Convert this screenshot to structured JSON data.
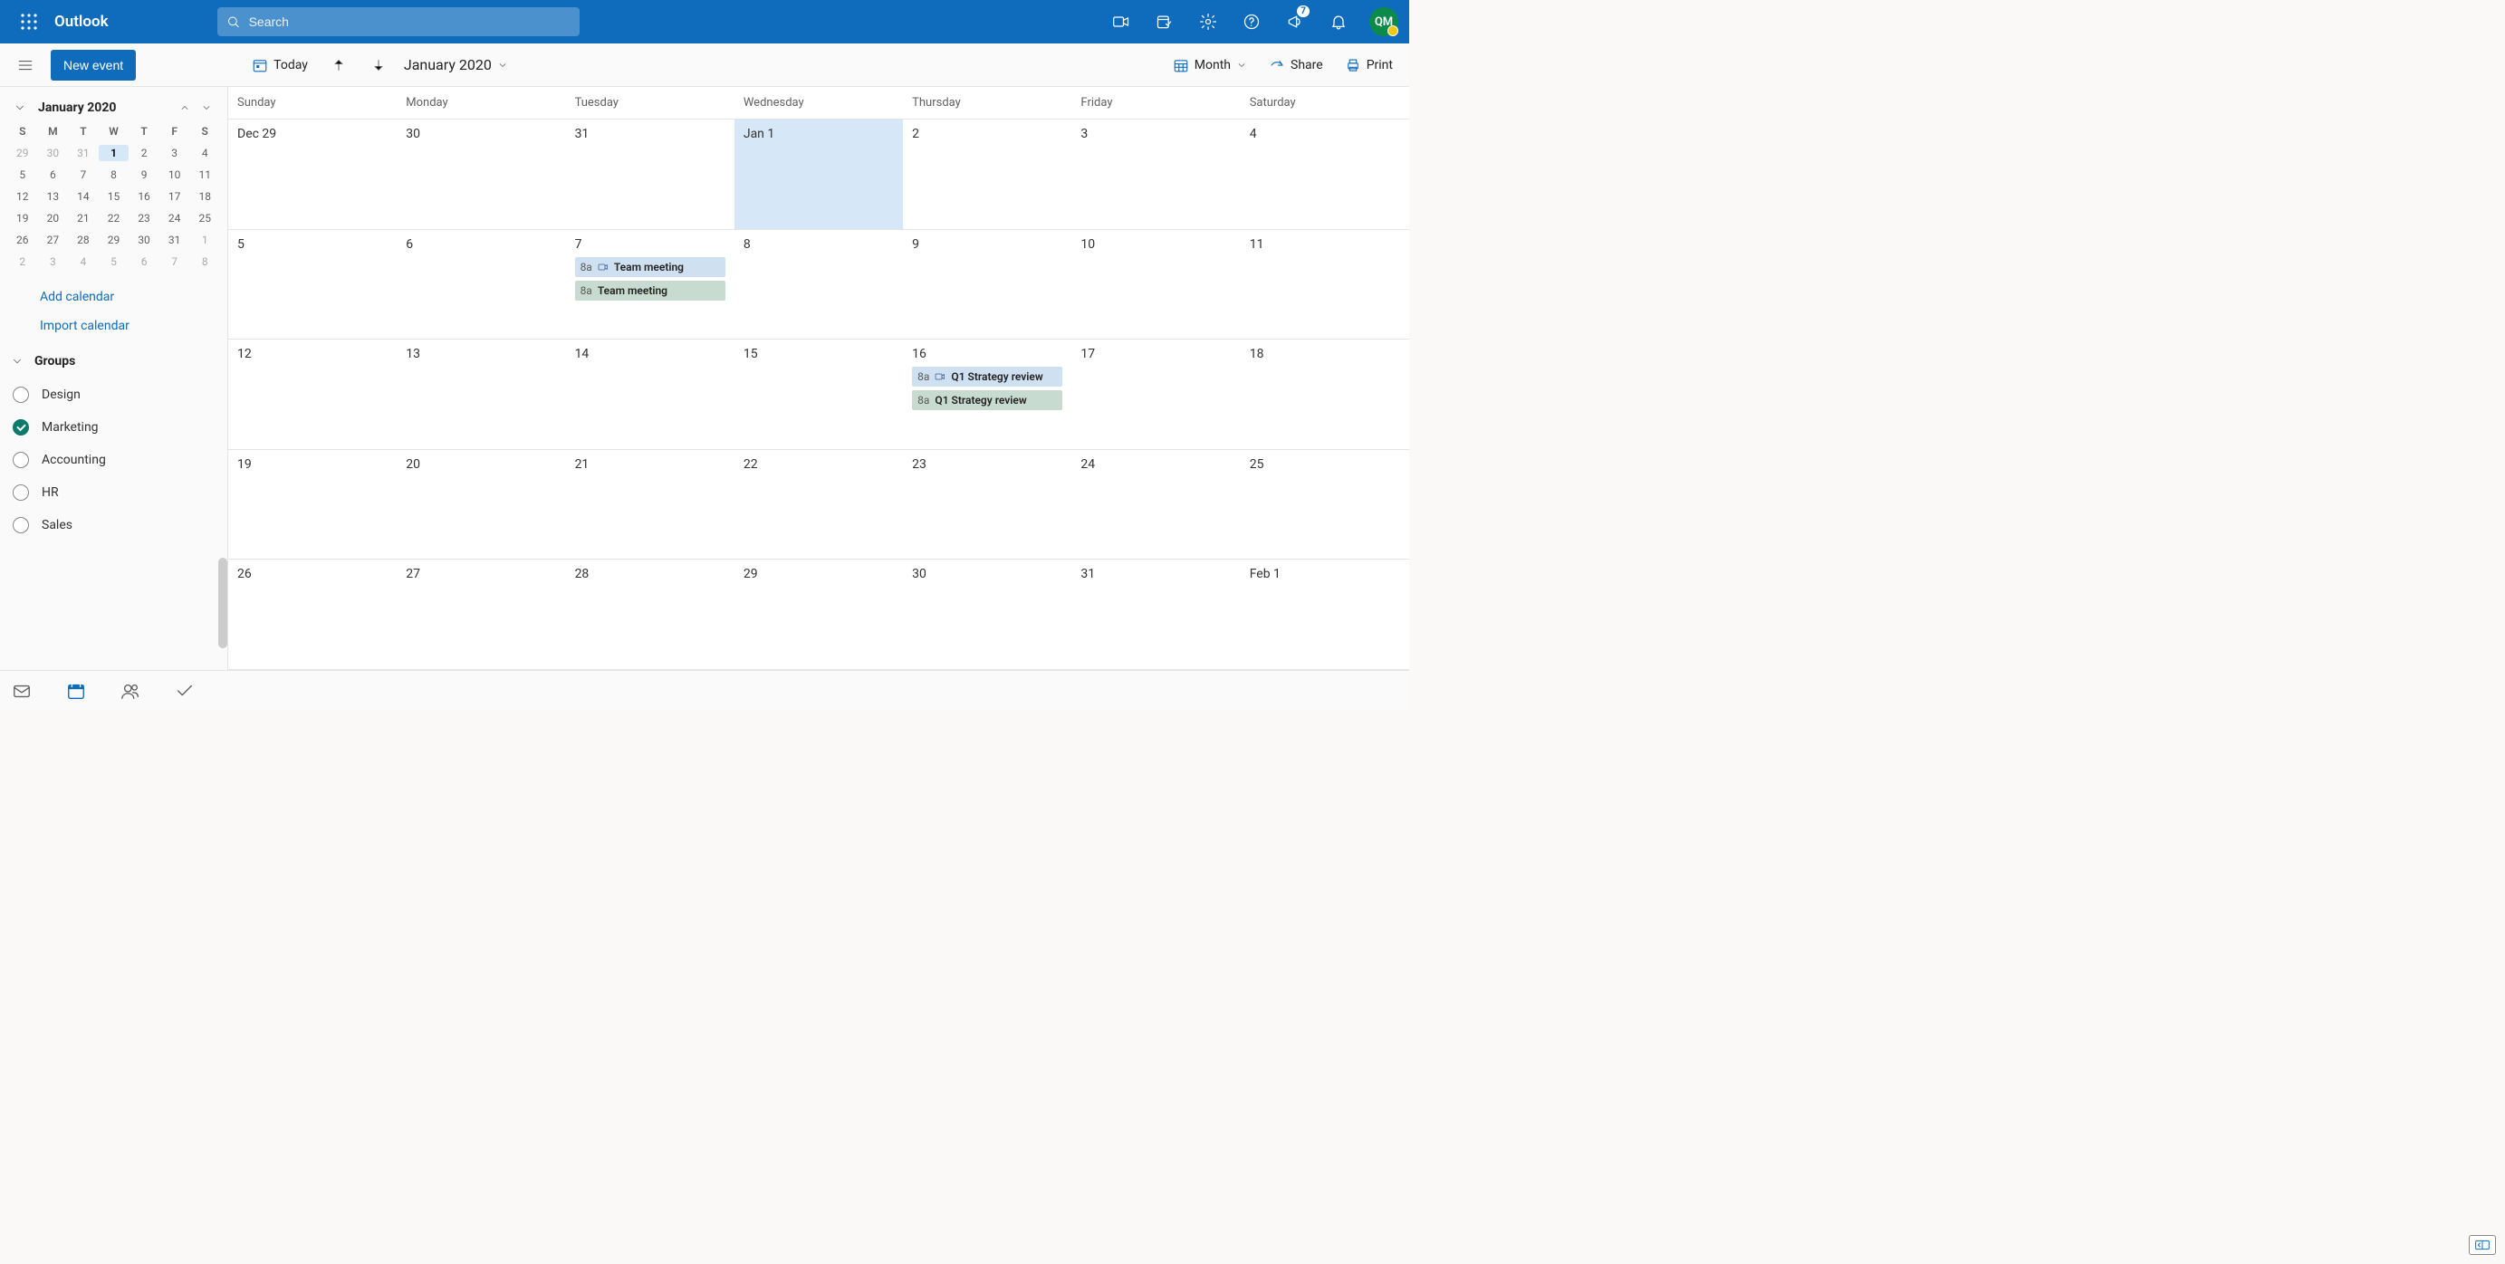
{
  "header": {
    "brand": "Outlook",
    "search_placeholder": "Search",
    "whats_new_badge": "7",
    "avatar_initials": "QM"
  },
  "commandbar": {
    "new_event": "New event",
    "today": "Today",
    "title": "January 2020",
    "view": "Month",
    "share": "Share",
    "print": "Print"
  },
  "sidebar": {
    "mini_title": "January 2020",
    "dow": [
      "S",
      "M",
      "T",
      "W",
      "T",
      "F",
      "S"
    ],
    "days": [
      [
        "29",
        "30",
        "31",
        "1",
        "2",
        "3",
        "4"
      ],
      [
        "5",
        "6",
        "7",
        "8",
        "9",
        "10",
        "11"
      ],
      [
        "12",
        "13",
        "14",
        "15",
        "16",
        "17",
        "18"
      ],
      [
        "19",
        "20",
        "21",
        "22",
        "23",
        "24",
        "25"
      ],
      [
        "26",
        "27",
        "28",
        "29",
        "30",
        "31",
        "1"
      ],
      [
        "2",
        "3",
        "4",
        "5",
        "6",
        "7",
        "8"
      ]
    ],
    "today_index": [
      0,
      3
    ],
    "other_month_start": [
      [
        0,
        0
      ],
      [
        0,
        1
      ],
      [
        0,
        2
      ],
      [
        4,
        6
      ],
      [
        5,
        0
      ],
      [
        5,
        1
      ],
      [
        5,
        2
      ],
      [
        5,
        3
      ],
      [
        5,
        4
      ],
      [
        5,
        5
      ],
      [
        5,
        6
      ]
    ],
    "add_calendar": "Add calendar",
    "import_calendar": "Import calendar",
    "groups_label": "Groups",
    "groups": [
      {
        "label": "Design",
        "checked": false
      },
      {
        "label": "Marketing",
        "checked": true
      },
      {
        "label": "Accounting",
        "checked": false
      },
      {
        "label": "HR",
        "checked": false
      },
      {
        "label": "Sales",
        "checked": false
      }
    ]
  },
  "calendar": {
    "dow": [
      "Sunday",
      "Monday",
      "Tuesday",
      "Wednesday",
      "Thursday",
      "Friday",
      "Saturday"
    ],
    "weeks": [
      {
        "days": [
          "Dec 29",
          "30",
          "31",
          "Jan 1",
          "2",
          "3",
          "4"
        ],
        "today": 3,
        "events": {}
      },
      {
        "days": [
          "5",
          "6",
          "7",
          "8",
          "9",
          "10",
          "11"
        ],
        "today": -1,
        "events": {
          "2": [
            {
              "time": "8a",
              "title": "Team meeting",
              "variant": "blue",
              "teams": true
            },
            {
              "time": "8a",
              "title": "Team meeting",
              "variant": "green",
              "teams": false
            }
          ]
        }
      },
      {
        "days": [
          "12",
          "13",
          "14",
          "15",
          "16",
          "17",
          "18"
        ],
        "today": -1,
        "events": {
          "4": [
            {
              "time": "8a",
              "title": "Q1 Strategy review",
              "variant": "blue",
              "teams": true
            },
            {
              "time": "8a",
              "title": "Q1 Strategy review",
              "variant": "green",
              "teams": false
            }
          ]
        }
      },
      {
        "days": [
          "19",
          "20",
          "21",
          "22",
          "23",
          "24",
          "25"
        ],
        "today": -1,
        "events": {}
      },
      {
        "days": [
          "26",
          "27",
          "28",
          "29",
          "30",
          "31",
          "Feb 1"
        ],
        "today": -1,
        "events": {}
      }
    ]
  }
}
